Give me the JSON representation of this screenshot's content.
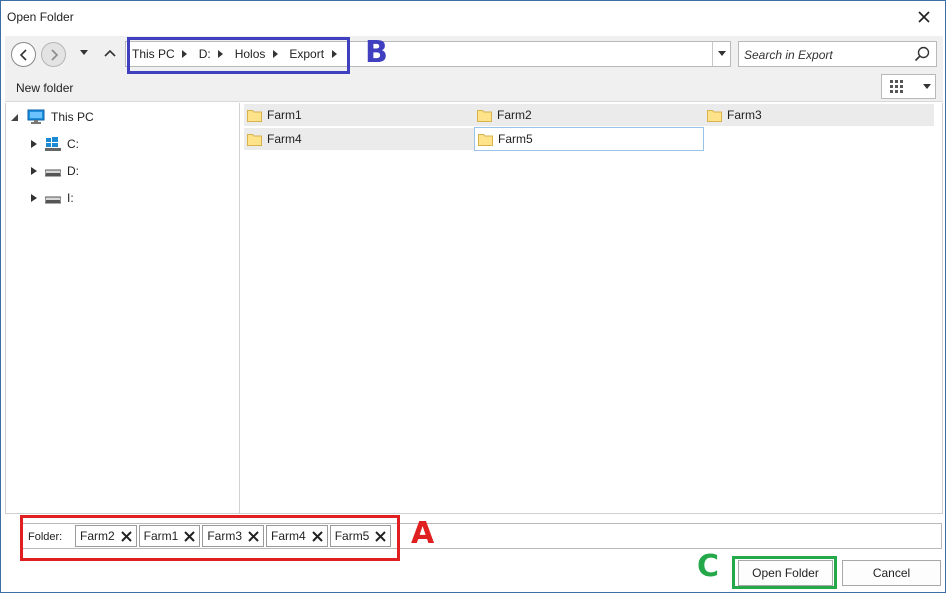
{
  "window": {
    "title": "Open Folder"
  },
  "nav": {
    "breadcrumbs": [
      "This PC",
      "D:",
      "Holos",
      "Export"
    ],
    "search_placeholder": "Search in Export"
  },
  "toolbar": {
    "new_folder_label": "New folder"
  },
  "tree": {
    "root": "This PC",
    "drives": [
      "C:",
      "D:",
      "I:"
    ]
  },
  "folders": [
    {
      "name": "Farm1",
      "selected": false
    },
    {
      "name": "Farm2",
      "selected": false
    },
    {
      "name": "Farm3",
      "selected": false
    },
    {
      "name": "Farm4",
      "selected": false
    },
    {
      "name": "Farm5",
      "selected": true
    }
  ],
  "folder_field": {
    "caption": "Folder:",
    "chips": [
      "Farm2",
      "Farm1",
      "Farm3",
      "Farm4",
      "Farm5"
    ]
  },
  "buttons": {
    "open_label": "Open Folder",
    "cancel_label": "Cancel"
  },
  "annotations": {
    "a": "A",
    "b": "B",
    "c": "C"
  },
  "colors": {
    "annotation_a": "#e02020",
    "annotation_b": "#3f3fbf",
    "annotation_c": "#24a84a",
    "folder_fill": "#ffe38a",
    "selection_border": "#99c4e8"
  }
}
